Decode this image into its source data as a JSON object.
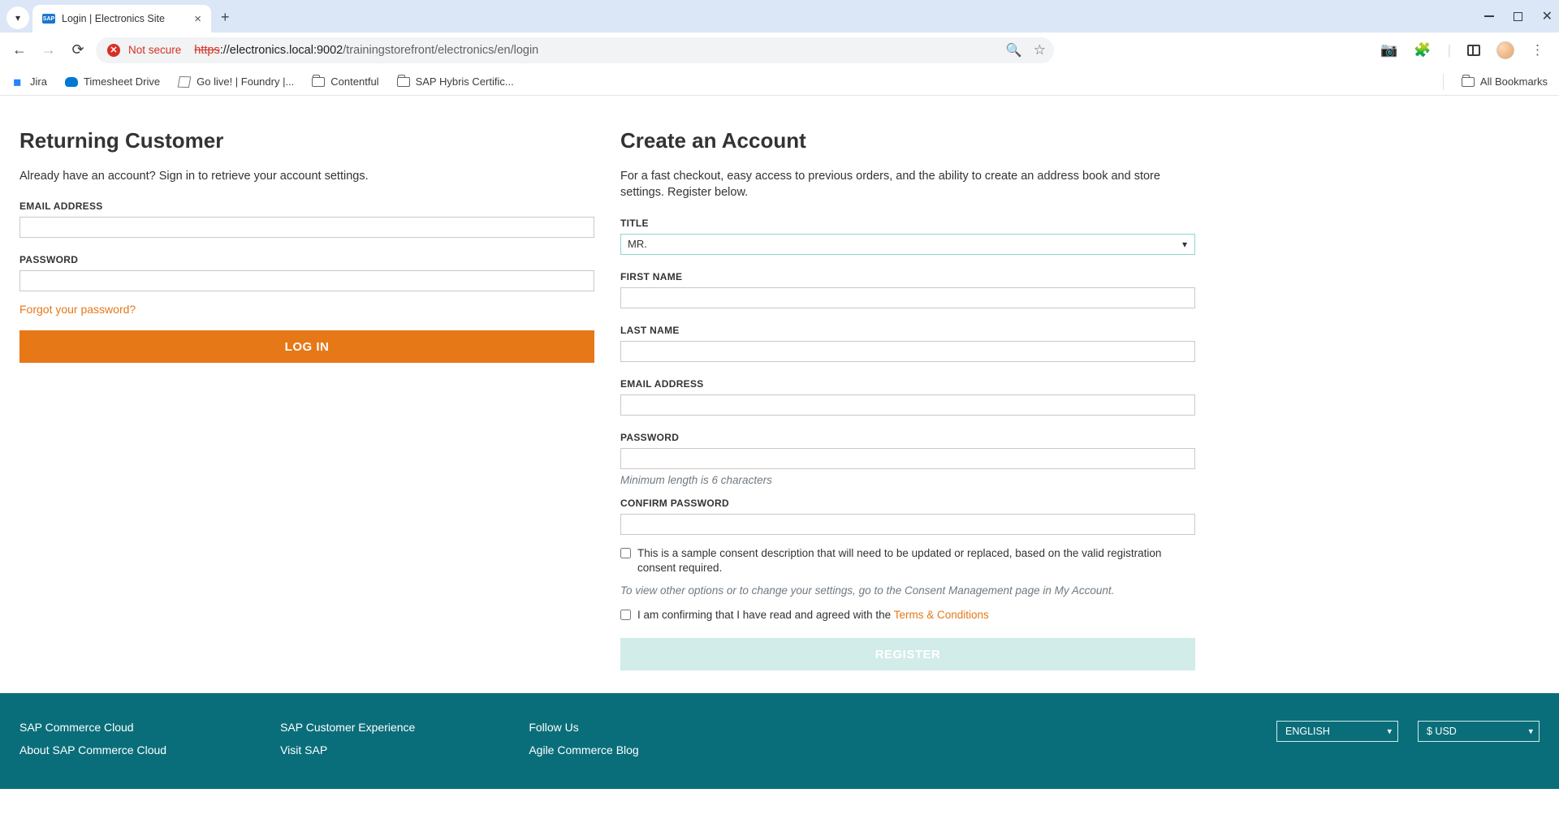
{
  "browser": {
    "tab_title": "Login | Electronics Site",
    "address": {
      "not_secure_label": "Not secure",
      "protocol": "https",
      "host": "://electronics.local:9002",
      "path": "/trainingstorefront/electronics/en/login"
    },
    "bookmarks": {
      "jira": "Jira",
      "timesheet": "Timesheet Drive",
      "golive": "Go live! | Foundry |...",
      "contentful": "Contentful",
      "hybris": "SAP Hybris Certific...",
      "all": "All Bookmarks"
    }
  },
  "login": {
    "heading": "Returning Customer",
    "desc": "Already have an account? Sign in to retrieve your account settings.",
    "email_label": "EMAIL ADDRESS",
    "password_label": "PASSWORD",
    "forgot": "Forgot your password?",
    "button": "LOG IN"
  },
  "register": {
    "heading": "Create an Account",
    "desc": "For a fast checkout, easy access to previous orders, and the ability to create an address book and store settings. Register below.",
    "title_label": "TITLE",
    "title_value": "MR.",
    "first_name_label": "FIRST NAME",
    "last_name_label": "LAST NAME",
    "email_label": "EMAIL ADDRESS",
    "password_label": "PASSWORD",
    "password_hint": "Minimum length is 6 characters",
    "confirm_label": "CONFIRM PASSWORD",
    "consent_text": "This is a sample consent description that will need to be updated or replaced, based on the valid registration consent required.",
    "consent_note": "To view other options or to change your settings, go to the Consent Management page in My Account.",
    "terms_prefix": "I am confirming that I have read and agreed with the ",
    "terms_link": "Terms & Conditions",
    "button": "REGISTER"
  },
  "footer": {
    "col1": {
      "a": "SAP Commerce Cloud",
      "b": "About SAP Commerce Cloud"
    },
    "col2": {
      "a": "SAP Customer Experience",
      "b": "Visit SAP"
    },
    "col3": {
      "a": "Follow Us",
      "b": "Agile Commerce Blog"
    },
    "lang": "ENGLISH",
    "currency": "$ USD"
  }
}
